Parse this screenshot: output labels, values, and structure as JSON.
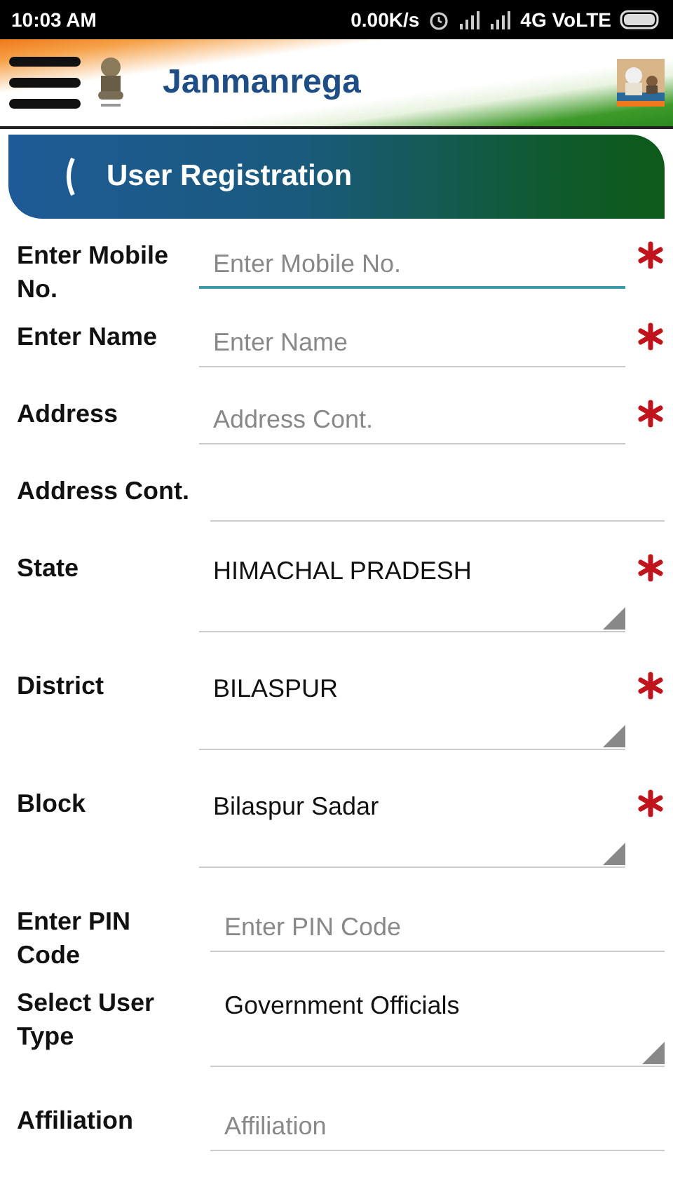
{
  "status_bar": {
    "time": "10:03 AM",
    "speed": "0.00K/s",
    "network": "4G VoLTE"
  },
  "header": {
    "title": "Janmanrega"
  },
  "banner": {
    "title": "User Registration"
  },
  "fields": [
    {
      "kind": "text",
      "label": "Enter Mobile No.",
      "placeholder": "Enter Mobile No.",
      "required": true,
      "focused": true
    },
    {
      "kind": "text",
      "label": "Enter Name",
      "placeholder": "Enter Name",
      "required": true,
      "focused": false
    },
    {
      "kind": "text",
      "label": "Address",
      "placeholder": "Address Cont.",
      "required": true,
      "focused": false
    },
    {
      "kind": "text",
      "label": "Address Cont.",
      "required": false,
      "focused": false
    },
    {
      "kind": "select",
      "label": "State",
      "value": "HIMACHAL PRADESH",
      "required": true
    },
    {
      "kind": "select",
      "label": "District",
      "value": "BILASPUR",
      "required": true
    },
    {
      "kind": "select",
      "label": "Block",
      "value": "Bilaspur Sadar",
      "required": true
    },
    {
      "kind": "text",
      "label": "Enter PIN Code",
      "placeholder": "Enter PIN Code",
      "required": false,
      "focused": false
    },
    {
      "kind": "select",
      "label": "Select User Type",
      "value": "Government Officials",
      "required": false
    },
    {
      "kind": "text",
      "label": "Affiliation",
      "placeholder": "Affiliation",
      "required": false,
      "focused": false
    }
  ]
}
